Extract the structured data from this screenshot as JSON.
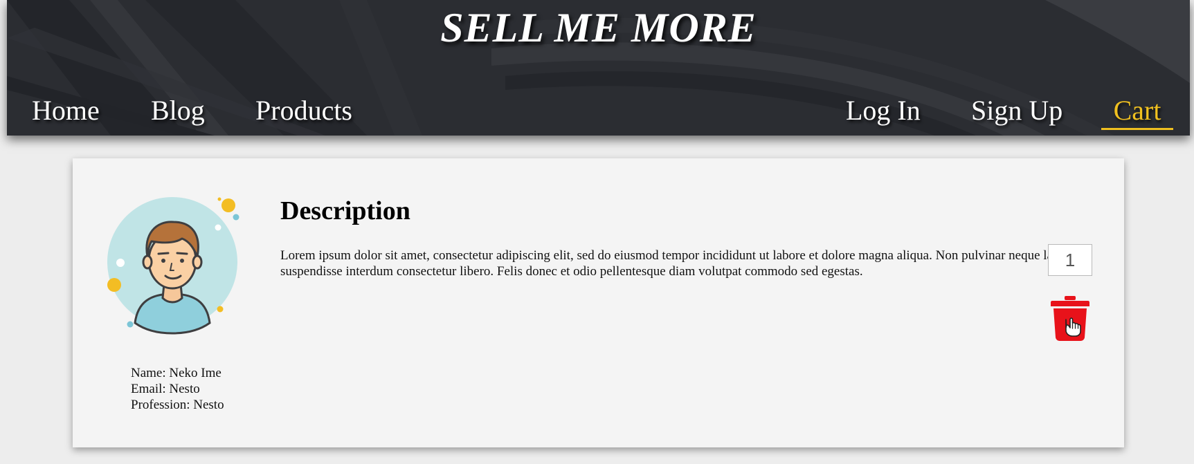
{
  "header": {
    "title": "SELL ME MORE",
    "nav_left": [
      "Home",
      "Blog",
      "Products"
    ],
    "nav_right": [
      "Log In",
      "Sign Up",
      "Cart"
    ],
    "active_nav": "Cart"
  },
  "profile": {
    "name_line": "Name: Neko Ime",
    "email_line": "Email: Nesto",
    "profession_line": "Profession: Nesto"
  },
  "description": {
    "title": "Description",
    "text": "Lorem ipsum dolor sit amet, consectetur adipiscing elit, sed do eiusmod tempor incididunt ut labore et dolore magna aliqua. Non pulvinar neque laoreet suspendisse interdum consectetur libero. Felis donec et odio pellentesque diam volutpat commodo sed egestas."
  },
  "cart_item": {
    "quantity": "1",
    "delete_icon": "trash-icon"
  },
  "colors": {
    "accent": "#f0c020",
    "delete": "#e8121a",
    "header_bg": "#2a2c31",
    "page_bg": "#ededed",
    "card_bg": "#f4f4f4"
  }
}
